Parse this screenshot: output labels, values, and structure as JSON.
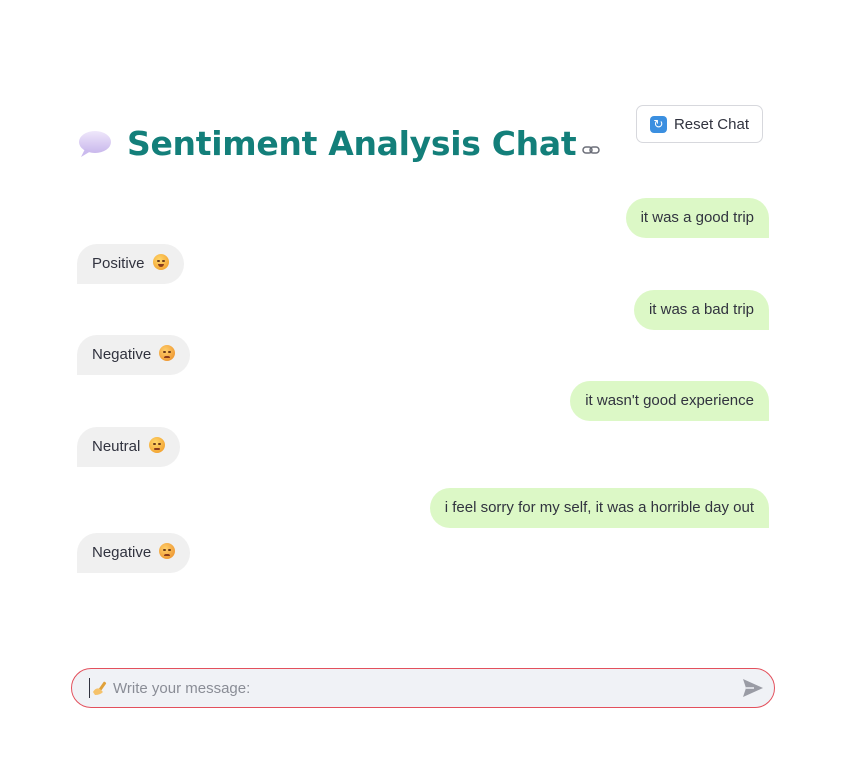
{
  "header": {
    "title": "Sentiment Analysis Chat",
    "reset_label": "Reset Chat"
  },
  "messages": [
    {
      "role": "user",
      "text": "it was a good trip"
    },
    {
      "role": "bot",
      "text": "Positive",
      "emoji": "smiling-face"
    },
    {
      "role": "user",
      "text": "it was a bad trip"
    },
    {
      "role": "bot",
      "text": "Negative",
      "emoji": "pensive-face"
    },
    {
      "role": "user",
      "text": "it wasn't good experience"
    },
    {
      "role": "bot",
      "text": "Neutral",
      "emoji": "neutral-face"
    },
    {
      "role": "user",
      "text": "i feel sorry for my self, it was a horrible day out"
    },
    {
      "role": "bot",
      "text": "Negative",
      "emoji": "pensive-face"
    }
  ],
  "input": {
    "placeholder": "Write your message:",
    "value": ""
  },
  "colors": {
    "title": "#137f7a",
    "user_bubble": "#dcf8c6",
    "bot_bubble": "#f0f0f0",
    "input_border": "#e3505c"
  }
}
